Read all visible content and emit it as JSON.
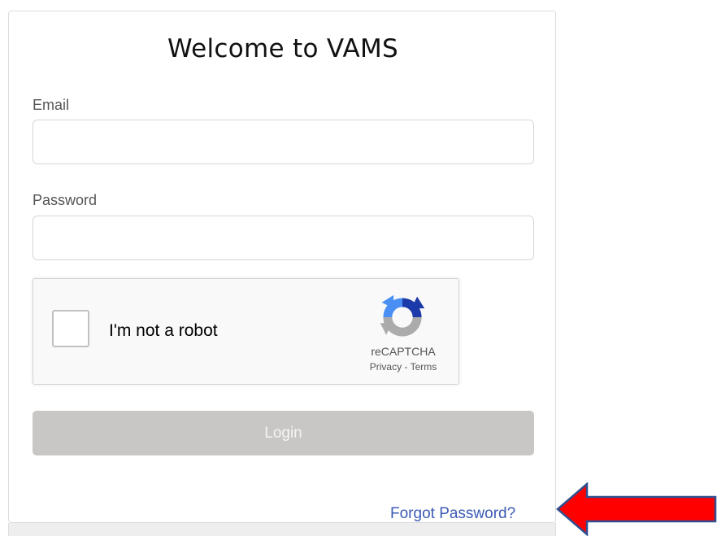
{
  "login_form": {
    "title": "Welcome to VAMS",
    "email_label": "Email",
    "email_value": "",
    "email_placeholder": "",
    "password_label": "Password",
    "password_value": "",
    "password_placeholder": "",
    "login_label": "Login",
    "forgot_password_label": "Forgot Password?"
  },
  "recaptcha": {
    "checkbox_label": "I'm not a robot",
    "brand": "reCAPTCHA",
    "privacy_label": "Privacy",
    "separator": " - ",
    "terms_label": "Terms",
    "checked": false
  },
  "annotation": {
    "arrow_icon": "red-arrow-icon",
    "arrow_color": "#ff0000",
    "arrow_outline_color": "#2f4f8f"
  },
  "colors": {
    "link": "#3b5bb5",
    "login_button_disabled": "#c8c7c5"
  }
}
